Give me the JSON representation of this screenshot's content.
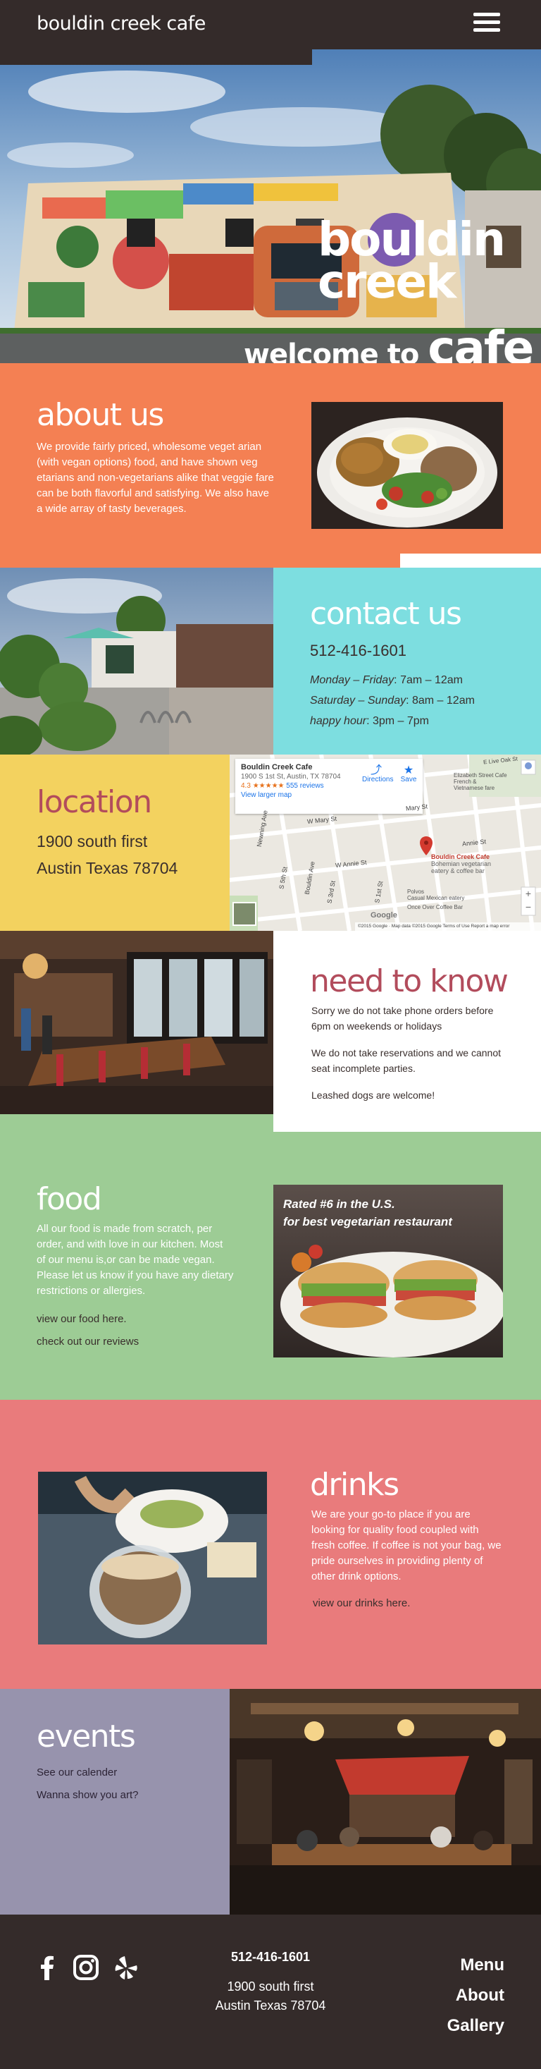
{
  "header": {
    "logo": "bouldin creek cafe",
    "menu_icon": "hamburger-menu-icon"
  },
  "hero": {
    "mural_title_1": "bouldin",
    "mural_title_2": "creek",
    "welcome_small": "welcome to",
    "welcome_big": "cafe"
  },
  "about": {
    "heading": "about us",
    "text": "We provide fairly priced, wholesome veget arian (with vegan options) food, and have shown veg etarians and non-vegetarians alike that veggie fare can be both flavorful and satisfying. We also have a wide array of tasty beverages."
  },
  "contact": {
    "heading": "contact us",
    "phone": "512-416-1601",
    "hours": [
      {
        "label": "Monday – Friday",
        "value": ": 7am – 12am"
      },
      {
        "label": "Saturday – Sunday",
        "value": ": 8am – 12am"
      },
      {
        "label": "happy hour",
        "value": ": 3pm – 7pm"
      }
    ]
  },
  "location": {
    "heading": "location",
    "line1": "1900 south first",
    "line2": "Austin Texas 78704",
    "map": {
      "place_name": "Bouldin Creek Cafe",
      "place_address": "1900 S 1st St, Austin, TX 78704",
      "rating": "4.3",
      "stars": "★★★★★",
      "reviews": "555 reviews",
      "view_larger": "View larger map",
      "directions": "Directions",
      "save": "Save",
      "pin_label_1": "Bouldin Creek Cafe",
      "pin_label_2": "Bohemian vegetarian",
      "pin_label_3": "eatery & coffee bar",
      "poi_1": "Elizabeth Street Cafe",
      "poi_2": "French &",
      "poi_3": "Vietnamese fare",
      "poi_4": "Polvos",
      "poi_5": "Casual Mexican eatery",
      "poi_6": "Once Over Coffee Bar",
      "street_1": "W Mary St",
      "street_2": "Mary St",
      "street_3": "W Annie St",
      "street_4": "Annie St",
      "street_5": "S 1st St",
      "street_6": "S 3rd St",
      "street_7": "S 5th St",
      "street_8": "Newning Ave",
      "street_9": "Bouldin Ave",
      "street_10": "E Live Oak St",
      "zoom_in": "+",
      "zoom_out": "−",
      "google": "Google",
      "footer": "©2015 Google · Map data ©2015 Google   Terms of Use   Report a map error"
    }
  },
  "need": {
    "heading": "need to know",
    "p1": "Sorry we do not take phone orders before 6pm on weekends or holidays",
    "p2": "We do not take reservations and we cannot seat incomplete parties.",
    "p3": "Leashed dogs are welcome!"
  },
  "food": {
    "heading": "food",
    "text": "All our food is made from scratch, per order, and with love in our kitchen. Most  of our menu is,or can be made vegan. Please let us know if you have any dietary restrictions or allergies.",
    "link1": "view our food here.",
    "link2": "check out our reviews",
    "rated_1": "Rated #6 in the U.S.",
    "rated_2": "for best vegetarian  restaurant"
  },
  "drinks": {
    "heading": "drinks",
    "text": "We are your go-to place if you are looking for quality food coupled with fresh coffee. If coffee is not your bag, we pride ourselves in providing plenty of other drink options.",
    "link": "view our drinks here."
  },
  "events": {
    "heading": "events",
    "link1": "See our calender",
    "link2": "Wanna show you art?"
  },
  "footer": {
    "phone": "512-416-1601",
    "addr1": "1900 south first",
    "addr2": "Austin Texas 78704",
    "nav": [
      "Menu",
      "About",
      "Gallery"
    ],
    "social": [
      "facebook-icon",
      "instagram-icon",
      "yelp-icon"
    ]
  },
  "colors": {
    "dark": "#342b2a",
    "orange": "#f48053",
    "cyan": "#7ddee0",
    "yellow": "#f3d25f",
    "green": "#9dcc95",
    "coral": "#e97b7c",
    "lavender": "#9793ad",
    "rose": "#b24c5c"
  }
}
